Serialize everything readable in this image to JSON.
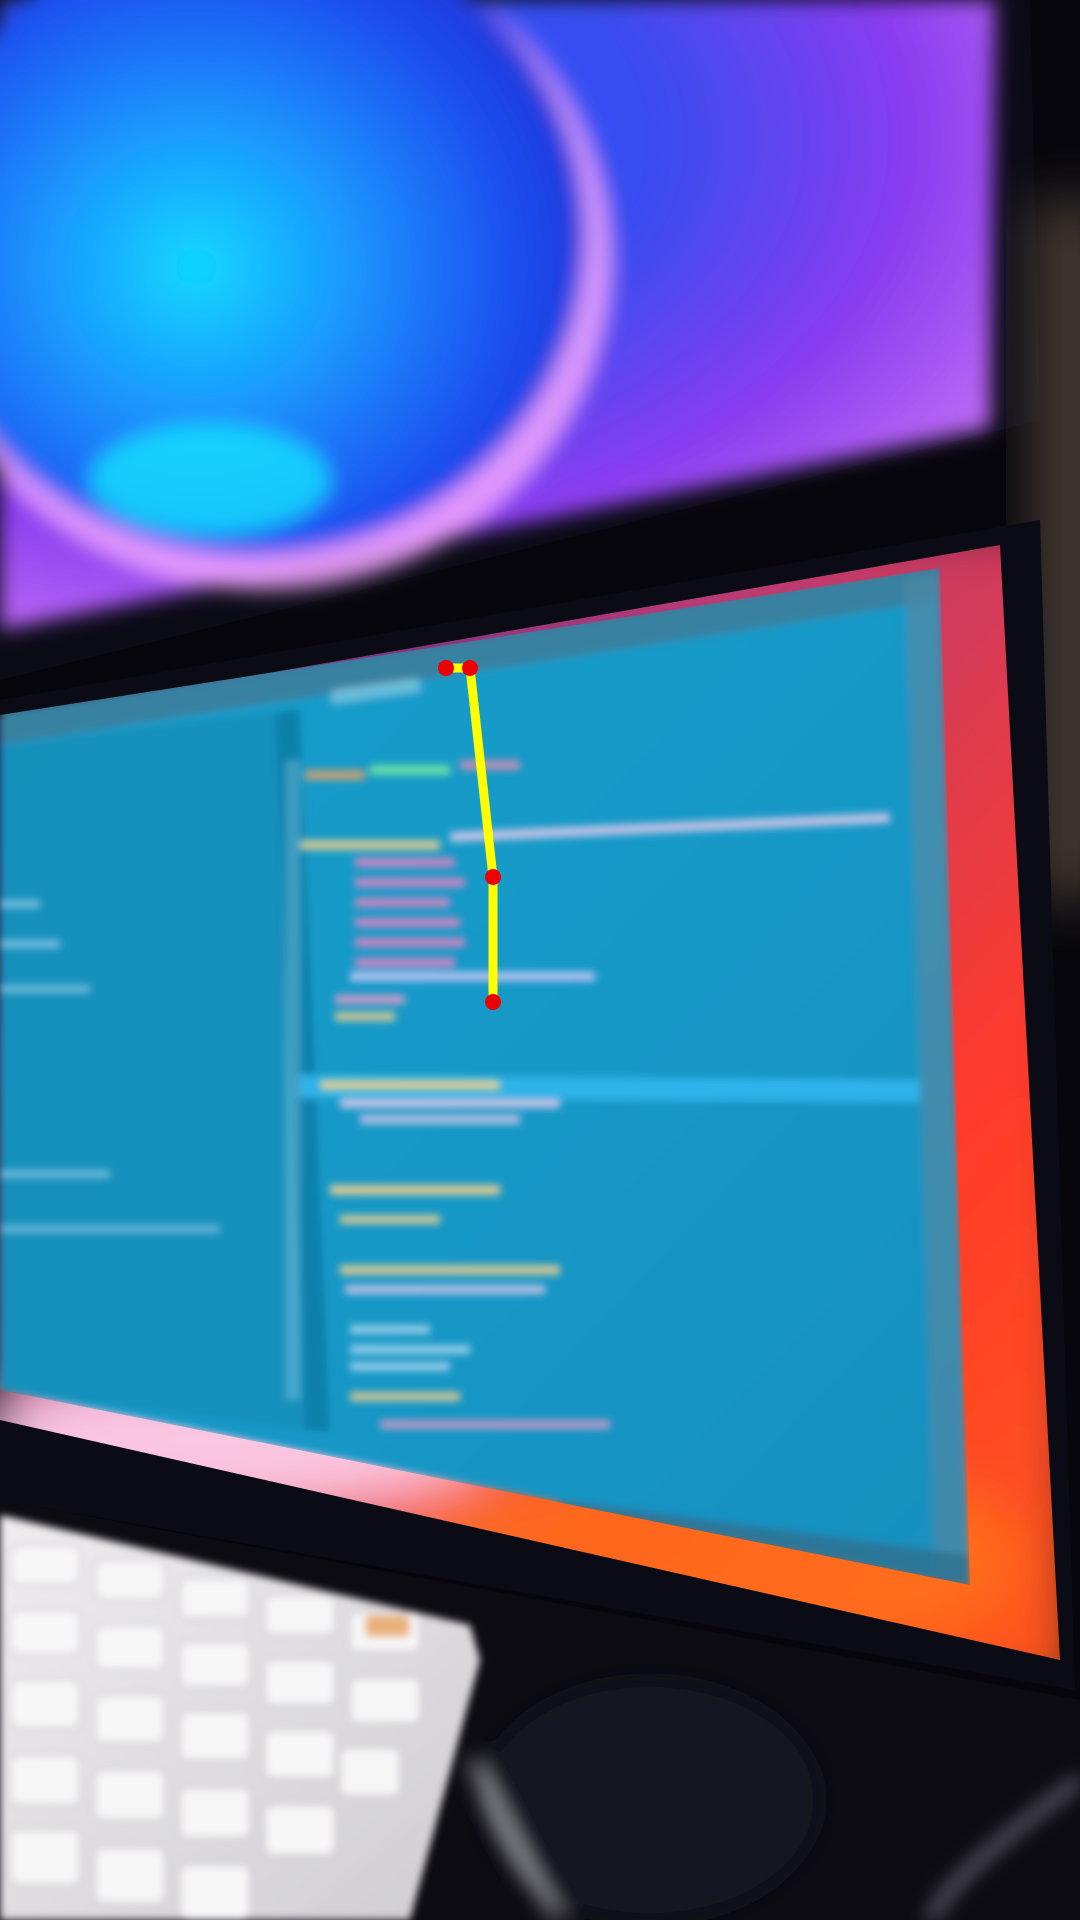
{
  "photo": {
    "subject": "blurred-photo-of-monitors-with-code-editor",
    "colors": {
      "room_dark": "#07060d",
      "wallpaper_blue": "#1a5cff",
      "wallpaper_cyan": "#10d8ff",
      "wallpaper_purple": "#8a3df0",
      "wallpaper_pink": "#e089ff",
      "wallpaper_red": "#ff3a2a",
      "wallpaper_orange": "#ff7a1a",
      "editor_bg": "#1597c6",
      "editor_highlight": "#2db3ea",
      "editor_gutter": "#138db8",
      "bezel": "#0b0b16",
      "keyboard": "#e6e4e6",
      "overlay_line": "#ffff00",
      "overlay_point": "#ee0000"
    }
  },
  "annotation": {
    "polyline_points": 4
  }
}
